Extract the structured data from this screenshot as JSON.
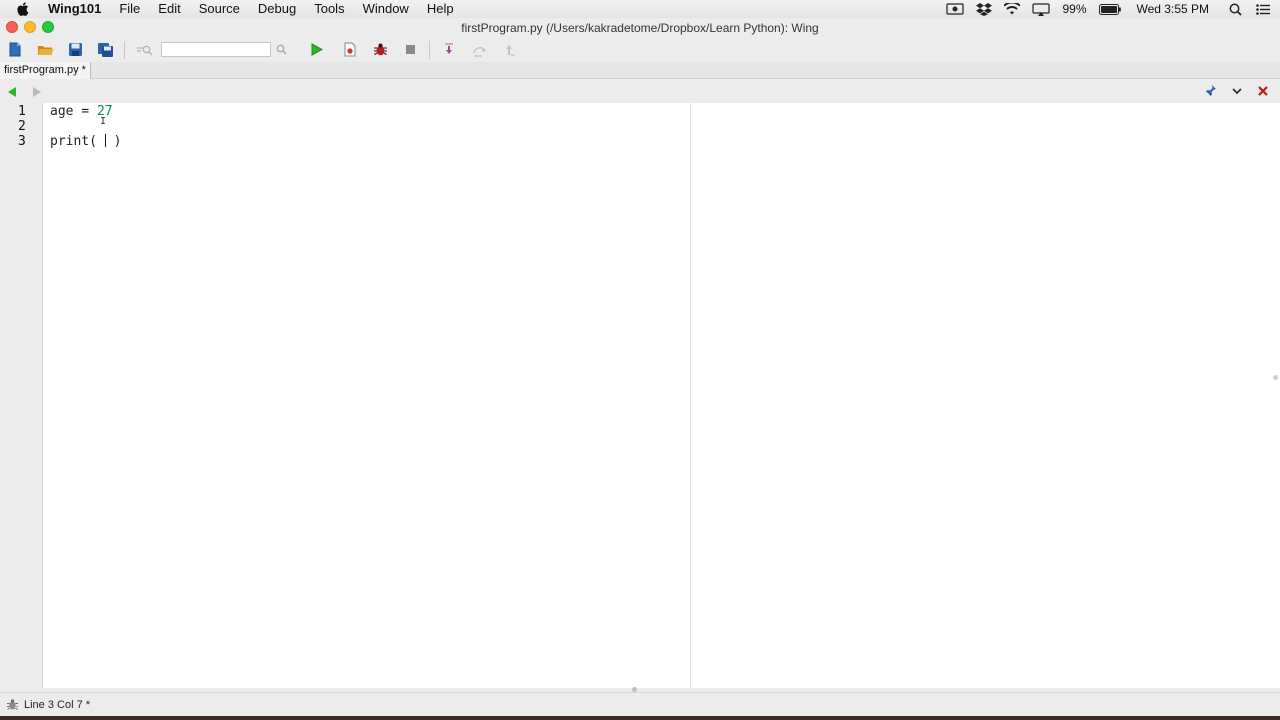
{
  "menubar": {
    "app_name": "Wing101",
    "items": [
      "File",
      "Edit",
      "Source",
      "Debug",
      "Tools",
      "Window",
      "Help"
    ],
    "battery": "99%",
    "clock": "Wed 3:55 PM"
  },
  "window": {
    "title": "firstProgram.py (/Users/kakradetome/Dropbox/Learn Python): Wing"
  },
  "tabs": [
    {
      "label": "firstProgram.py *"
    }
  ],
  "editor": {
    "line_numbers": [
      "1",
      "2",
      "3"
    ],
    "code": {
      "line1_var": "age",
      "line1_op": " = ",
      "line1_val": "27",
      "line3_call": "print( ",
      "line3_close": " )"
    }
  },
  "status": {
    "text": "Line 3 Col 7 *"
  },
  "colors": {
    "number": "#0a8a6a",
    "run": "#2fb52f",
    "close_x": "#cc1111"
  }
}
